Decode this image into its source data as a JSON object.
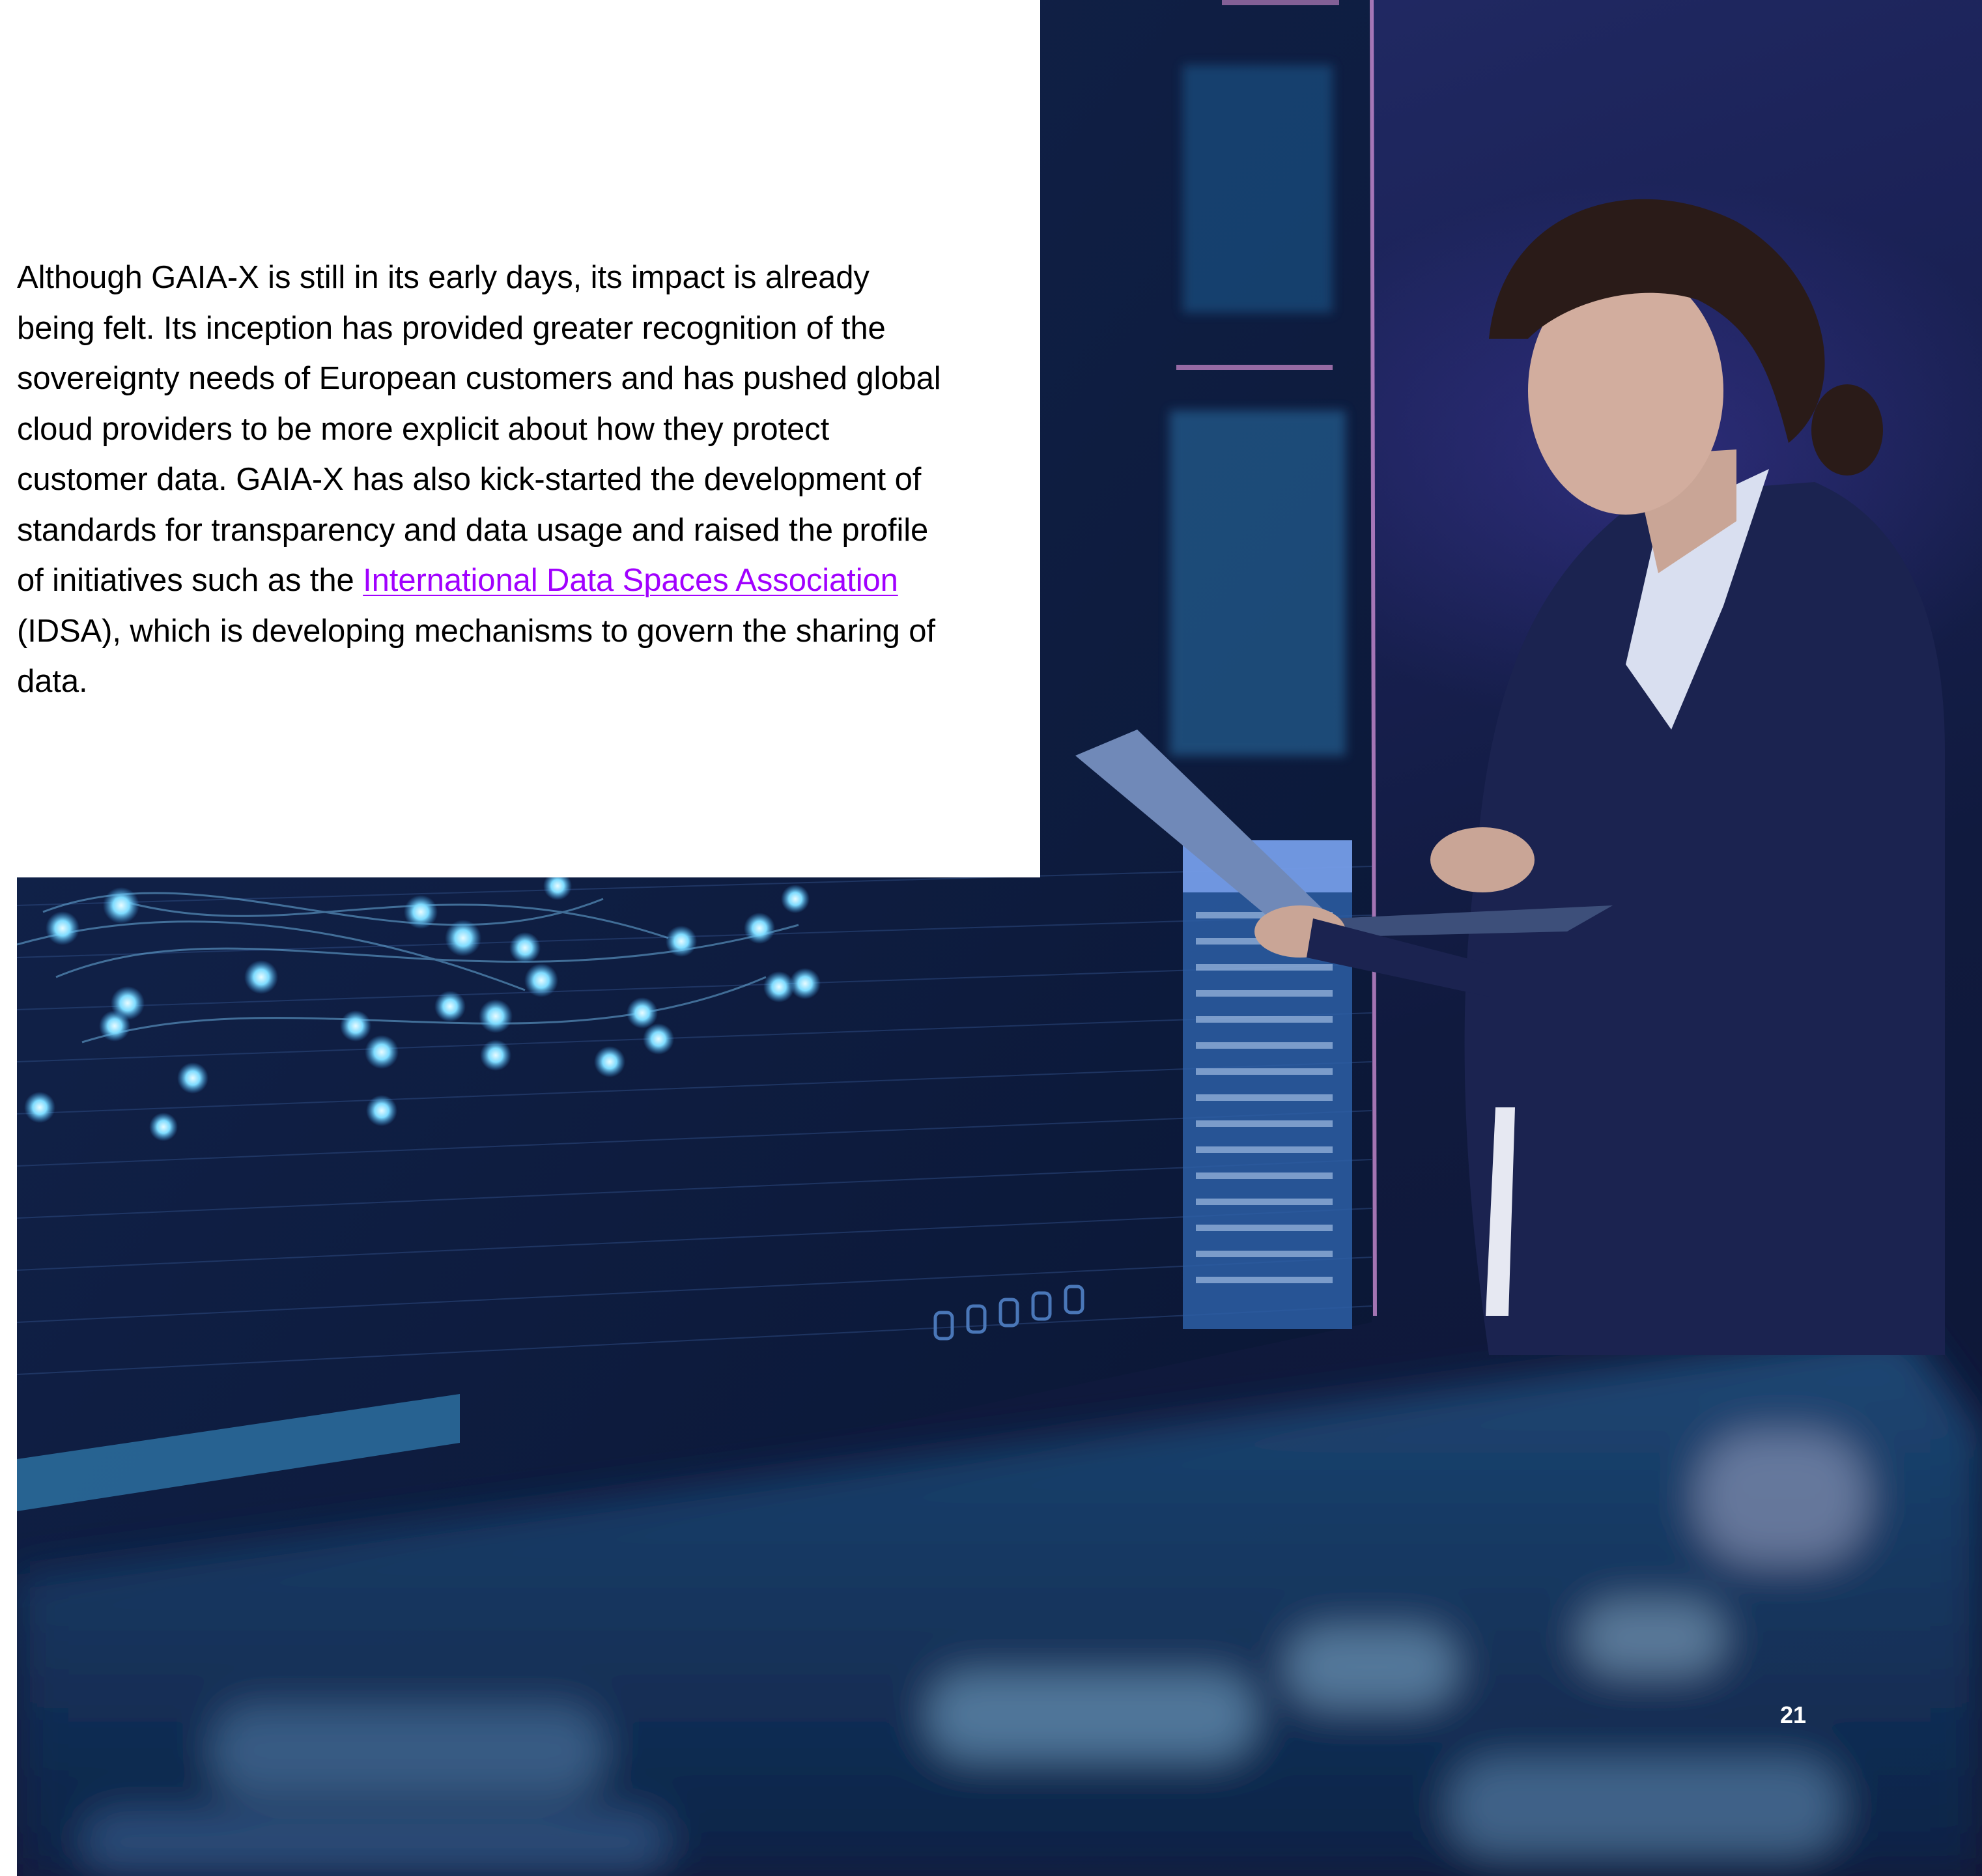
{
  "article": {
    "paragraph": {
      "text_before_link": "Although GAIA-X is still in its early days, its impact is already being felt. Its inception has provided greater recognition of the sovereignty needs of European customers and has pushed global cloud providers to be more explicit about how they protect customer data. GAIA-X has also kick-started the development of standards for transparency and data usage and raised the profile of initiatives such as the ",
      "link_text": "International Data Spaces Association",
      "text_after_link": " (IDSA), which is developing mechanisms to govern the sharing of data."
    }
  },
  "footer": {
    "page_number": "21"
  },
  "colors": {
    "link": "#a100ff",
    "text": "#000000",
    "photo_dark": "#0c1533",
    "photo_accent": "#6fd3ff"
  },
  "image": {
    "subject": "woman using laptop in front of glowing data display"
  }
}
